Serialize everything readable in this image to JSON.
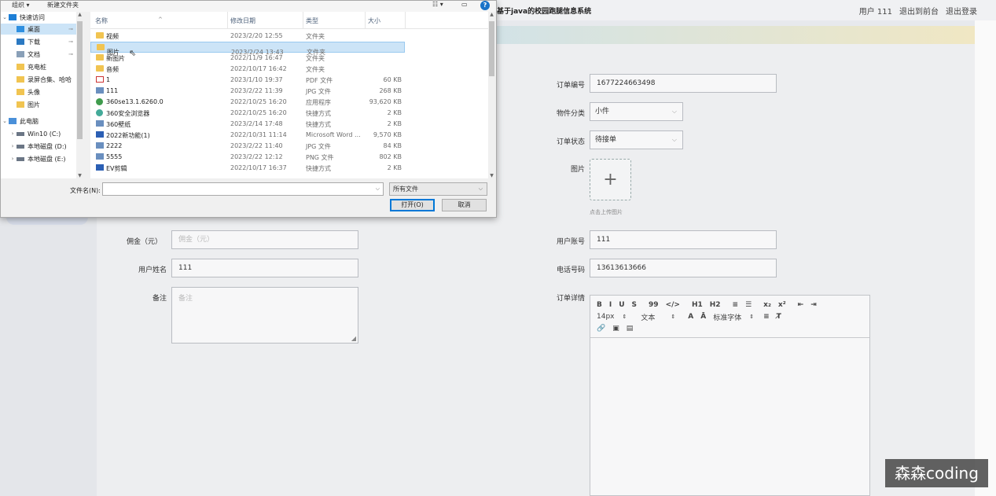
{
  "app": {
    "title": "基于java的校园跑腿信息系统",
    "nav": [
      "用户 111",
      "退出到前台",
      "退出登录"
    ]
  },
  "form": {
    "order_no": {
      "label": "订单编号",
      "value": "1677224663498"
    },
    "category": {
      "label": "物件分类",
      "value": "小件"
    },
    "status": {
      "label": "订单状态",
      "value": "待接单"
    },
    "image": {
      "label": "图片",
      "hint": "点击上传图片"
    },
    "commission": {
      "label": "佣金（元）",
      "placeholder": "佣金（元）"
    },
    "account": {
      "label": "用户账号",
      "value": "111"
    },
    "name": {
      "label": "用户姓名",
      "value": "111"
    },
    "phone": {
      "label": "电话号码",
      "value": "13613613666"
    },
    "remark": {
      "label": "备注",
      "placeholder": "备注"
    },
    "detail": {
      "label": "订单详情",
      "toolbar_row1": [
        "B",
        "I",
        "U",
        "S",
        "99",
        "</>",
        "H1",
        "H2",
        "≡",
        "☰",
        "x₂",
        "x²",
        "⇤",
        "⇥"
      ],
      "font_size": "14px",
      "text_type": "文本",
      "font_family": "标准字体"
    }
  },
  "watermark": "森森coding",
  "dialog": {
    "toolbar": {
      "organize": "组织 ▾",
      "new_folder": "新建文件夹",
      "help": "?"
    },
    "nav": [
      {
        "label": "快速访问",
        "type": "quick"
      },
      {
        "label": "桌面",
        "type": "desktop",
        "pinned": true,
        "active": true
      },
      {
        "label": "下载",
        "type": "download",
        "pinned": true
      },
      {
        "label": "文档",
        "type": "doc",
        "pinned": true
      },
      {
        "label": "充电桩",
        "type": "folder"
      },
      {
        "label": "录屏合集、哈哈",
        "type": "folder"
      },
      {
        "label": "头像",
        "type": "folder"
      },
      {
        "label": "图片",
        "type": "folder"
      },
      {
        "label": "此电脑",
        "type": "pc"
      },
      {
        "label": "Win10 (C:)",
        "type": "drive"
      },
      {
        "label": "本地磁盘 (D:)",
        "type": "drive"
      },
      {
        "label": "本地磁盘 (E:)",
        "type": "drive"
      }
    ],
    "columns": {
      "name": "名称",
      "date": "修改日期",
      "type": "类型",
      "size": "大小"
    },
    "files": [
      {
        "name": "视频",
        "date": "2023/2/20 12:55",
        "type": "文件夹",
        "size": "",
        "icon": "folder"
      },
      {
        "name": "图片",
        "date": "2023/2/24 13:43",
        "type": "文件夹",
        "size": "",
        "icon": "folder",
        "selected": true
      },
      {
        "name": "新图片",
        "date": "2022/11/9 16:47",
        "type": "文件夹",
        "size": "",
        "icon": "folder"
      },
      {
        "name": "音频",
        "date": "2022/10/17 16:42",
        "type": "文件夹",
        "size": "",
        "icon": "folder"
      },
      {
        "name": "1",
        "date": "2023/1/10 19:37",
        "type": "PDF 文件",
        "size": "60 KB",
        "icon": "pdf"
      },
      {
        "name": "111",
        "date": "2023/2/22 11:39",
        "type": "JPG 文件",
        "size": "268 KB",
        "icon": "jpg"
      },
      {
        "name": "360se13.1.6260.0",
        "date": "2022/10/25 16:20",
        "type": "应用程序",
        "size": "93,620 KB",
        "icon": "app"
      },
      {
        "name": "360安全浏览器",
        "date": "2022/10/25 16:20",
        "type": "快捷方式",
        "size": "2 KB",
        "icon": "lnk"
      },
      {
        "name": "360壁纸",
        "date": "2023/2/14 17:48",
        "type": "快捷方式",
        "size": "2 KB",
        "icon": "jpg"
      },
      {
        "name": "2022新功能(1)",
        "date": "2022/10/31 11:14",
        "type": "Microsoft Word ...",
        "size": "9,570 KB",
        "icon": "doc"
      },
      {
        "name": "2222",
        "date": "2023/2/22 11:40",
        "type": "JPG 文件",
        "size": "84 KB",
        "icon": "jpg"
      },
      {
        "name": "5555",
        "date": "2023/2/22 12:12",
        "type": "PNG 文件",
        "size": "802 KB",
        "icon": "jpg"
      },
      {
        "name": "EV剪辑",
        "date": "2022/10/17 16:37",
        "type": "快捷方式",
        "size": "2 KB",
        "icon": "doc"
      }
    ],
    "filename_label": "文件名(N):",
    "filename_value": "",
    "filetype": "所有文件",
    "open_button": "打开(O)",
    "cancel_button": "取消"
  }
}
